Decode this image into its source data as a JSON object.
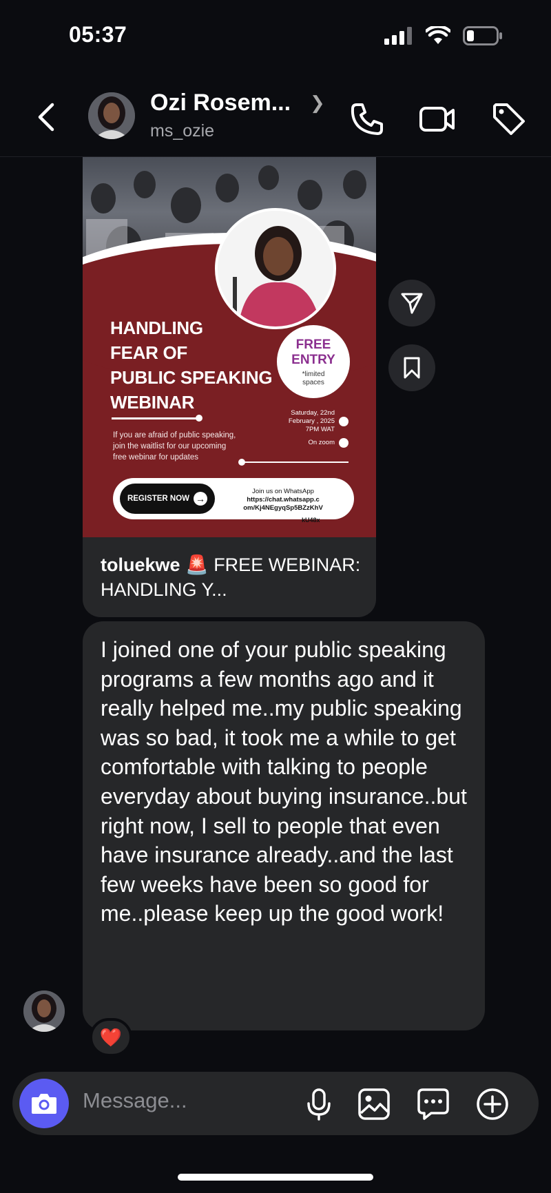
{
  "status_bar": {
    "time": "05:37",
    "battery_level": 0.25
  },
  "header": {
    "name": "Ozi Rosem...",
    "username": "ms_ozie"
  },
  "post": {
    "flyer": {
      "title_lines": [
        "HANDLING",
        "FEAR OF",
        "PUBLIC SPEAKING",
        "WEBINAR"
      ],
      "badge_main": [
        "FREE",
        "ENTRY"
      ],
      "badge_sub": [
        "*limited",
        "spaces"
      ],
      "description": "If you are afraid of public speaking, join the waitlist for our upcoming free webinar for updates",
      "date": [
        "Saturday, 22nd",
        "February , 2025",
        "7PM WAT"
      ],
      "location": "On zoom",
      "register": "REGISTER NOW",
      "whatsapp_label": "Join us on WhatsApp",
      "whatsapp_link": [
        "https://chat.whatsapp.c",
        "om/Kj4NEgyqSp5BZzKhV"
      ],
      "whatsapp_overflow": "kU48x"
    },
    "caption_user": "toluekwe",
    "caption_emoji": "🚨",
    "caption_text": "FREE WEBINAR: HANDLING Y..."
  },
  "message": {
    "text": "I joined one of your public speaking programs a few months ago and it really helped me..my public speaking was so bad, it took me a while to get comfortable with talking to people everyday about buying insurance..but right now, I sell to people that even have insurance already..and the last few weeks have been so good for me..please keep up the good work!",
    "reaction": "❤️"
  },
  "composer": {
    "placeholder": "Message..."
  },
  "colors": {
    "background": "#0b0c10",
    "bubble": "#262729",
    "accent_camera": "#5b5bf2",
    "flyer_red": "#7a1f23",
    "badge_purple": "#8b2f8f"
  },
  "icons": [
    "back-icon",
    "chevron-right-icon",
    "phone-icon",
    "video-icon",
    "tag-icon",
    "share-icon",
    "bookmark-icon",
    "camera-icon",
    "mic-icon",
    "image-icon",
    "sticker-icon",
    "plus-icon"
  ]
}
